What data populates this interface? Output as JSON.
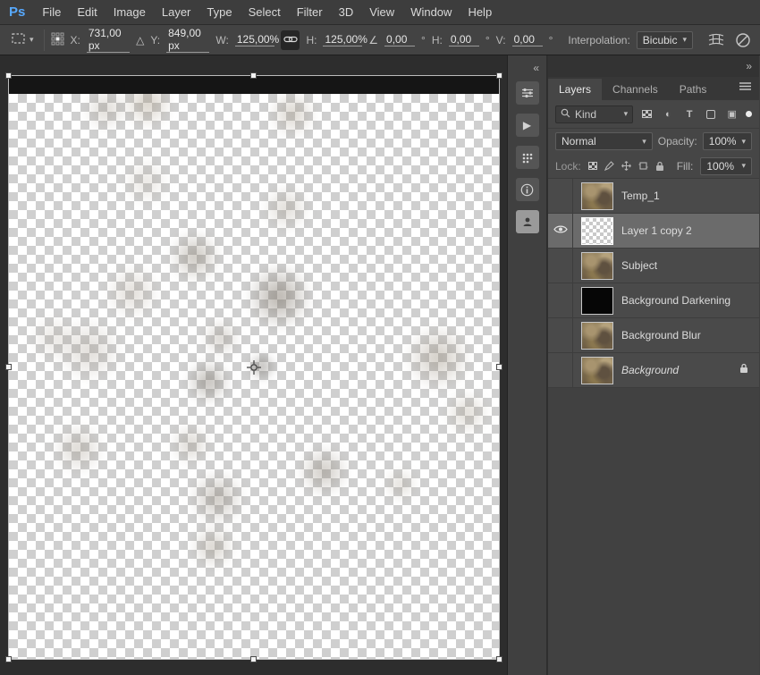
{
  "app": {
    "logo": "Ps"
  },
  "menu": {
    "items": [
      "File",
      "Edit",
      "Image",
      "Layer",
      "Type",
      "Select",
      "Filter",
      "3D",
      "View",
      "Window",
      "Help"
    ]
  },
  "options": {
    "x_label": "X:",
    "x_value": "731,00 px",
    "y_label": "Y:",
    "y_value": "849,00 px",
    "w_label": "W:",
    "w_value": "125,00%",
    "h_label": "H:",
    "h_value": "125,00%",
    "angle_value": "0,00",
    "h2_label": "H:",
    "h2_value": "0,00",
    "v_label": "V:",
    "v_value": "0,00",
    "interpolation_label": "Interpolation:",
    "interpolation_value": "Bicubic"
  },
  "icons": {
    "caret_down": "▾",
    "collapse_left": "«",
    "collapse_right": "»",
    "delta": "△",
    "angle": "∠",
    "degree": "°",
    "play": "▶",
    "adjustment": "◐",
    "type": "T",
    "smart_object": "▣"
  },
  "layers_panel": {
    "tabs": [
      "Layers",
      "Channels",
      "Paths"
    ],
    "kind_label": "Kind",
    "blend_mode": "Normal",
    "opacity_label": "Opacity:",
    "opacity_value": "100%",
    "lock_label": "Lock:",
    "fill_label": "Fill:",
    "fill_value": "100%",
    "layers": [
      {
        "name": "Temp_1"
      },
      {
        "name": "Layer 1 copy 2"
      },
      {
        "name": "Subject"
      },
      {
        "name": "Background Darkening"
      },
      {
        "name": "Background Blur"
      },
      {
        "name": "Background"
      }
    ]
  }
}
